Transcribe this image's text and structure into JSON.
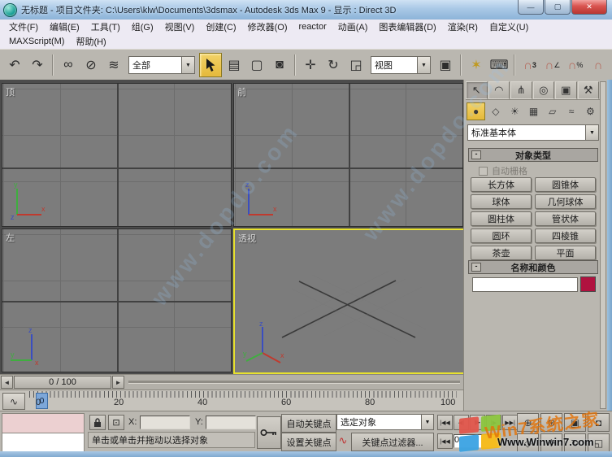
{
  "window": {
    "title": "无标题    - 项目文件夹: C:\\Users\\klw\\Documents\\3dsmax    - Autodesk 3ds Max 9    - 显示 : Direct 3D",
    "minimize": "—",
    "maximize": "▢",
    "close": "✕"
  },
  "menu": {
    "row1": [
      "文件(F)",
      "编辑(E)",
      "工具(T)",
      "组(G)",
      "视图(V)",
      "创建(C)",
      "修改器(O)",
      "reactor",
      "动画(A)",
      "图表编辑器(D)",
      "渲染(R)",
      "自定义(U)"
    ],
    "row2": [
      "MAXScript(M)",
      "帮助(H)"
    ]
  },
  "toolbar": {
    "selection_filter": "全部",
    "ref_coord": "视图"
  },
  "icons": {
    "undo": "↶",
    "redo": "↷",
    "link": "∞",
    "unlink": "⊘",
    "bind_spacewarp": "≋",
    "select_by_name": "▤",
    "rect_region": "▢",
    "window_crossing": "◙",
    "move": "✛",
    "rotate": "↻",
    "scale": "◲",
    "pivot_center": "▣",
    "manipulate": "✶",
    "keyboard_override": "⌨",
    "magnet": "∩",
    "snap_label": "3",
    "angle_label": "∠",
    "percent_label": "%",
    "dropdown_arrow": "▼",
    "tab_create": "↖",
    "tab_modify": "◠",
    "tab_hierarchy": "⋔",
    "tab_motion": "◎",
    "tab_display": "▣",
    "tab_utilities": "⚒",
    "cat_geometry": "●",
    "cat_shapes": "◇",
    "cat_lights": "☀",
    "cat_cameras": "▦",
    "cat_helpers": "▱",
    "cat_spacewarps": "≈",
    "cat_systems": "⚙",
    "rollout_minus": "-",
    "slider_left": "◄",
    "slider_right": "►",
    "curve_editor": "∿",
    "key_filter_curve": "∿",
    "goto_start": "|◀◀",
    "prev_frame": "◀|",
    "play": "▶",
    "next_frame": "|▶",
    "goto_end": "▶▶|",
    "nav_zoom": "⊕",
    "nav_zoom_all": "⊛",
    "nav_zoom_extents": "▣",
    "nav_zoom_extents_all": "◘",
    "nav_fov": "◇",
    "nav_pan": "✛",
    "nav_arc_rotate": "↻",
    "nav_maximize": "◱"
  },
  "viewports": {
    "top": {
      "label": "顶"
    },
    "front": {
      "label": "前"
    },
    "left": {
      "label": "左"
    },
    "perspective": {
      "label": "透视",
      "active": true
    }
  },
  "time_slider": {
    "value": "0 / 100"
  },
  "trackbar": {
    "ticks": [
      "0",
      "20",
      "40",
      "60",
      "80",
      "100"
    ],
    "current_frame": "0"
  },
  "status_bar": {
    "x_label": "X:",
    "y_label": "Y:",
    "x_value": "",
    "y_value": "",
    "prompt": "单击或单击并拖动以选择对象",
    "auto_key": "自动关键点",
    "set_key": "设置关键点",
    "selection_set": "选定对象",
    "key_filters": "关键点过滤器...",
    "frame_field": "0"
  },
  "command_panel": {
    "category_dropdown": "标准基本体",
    "object_type_rollout": "对象类型",
    "autogrid_label": "自动栅格",
    "object_buttons": [
      "长方体",
      "圆锥体",
      "球体",
      "几何球体",
      "圆柱体",
      "管状体",
      "圆环",
      "四棱锥",
      "茶壶",
      "平面"
    ],
    "name_color_rollout": "名称和颜色",
    "name_value": "",
    "swatch_color": "#b0123f"
  },
  "watermark": {
    "site_text": "Www.Winwin7.com",
    "brand_text": "Win7系统之家",
    "viewport_text": "www.dopdo.com"
  },
  "colors": {
    "active_viewport_border": "#e8e22f",
    "selection_highlight": "#e5b93a",
    "swatch": "#b0123f"
  }
}
